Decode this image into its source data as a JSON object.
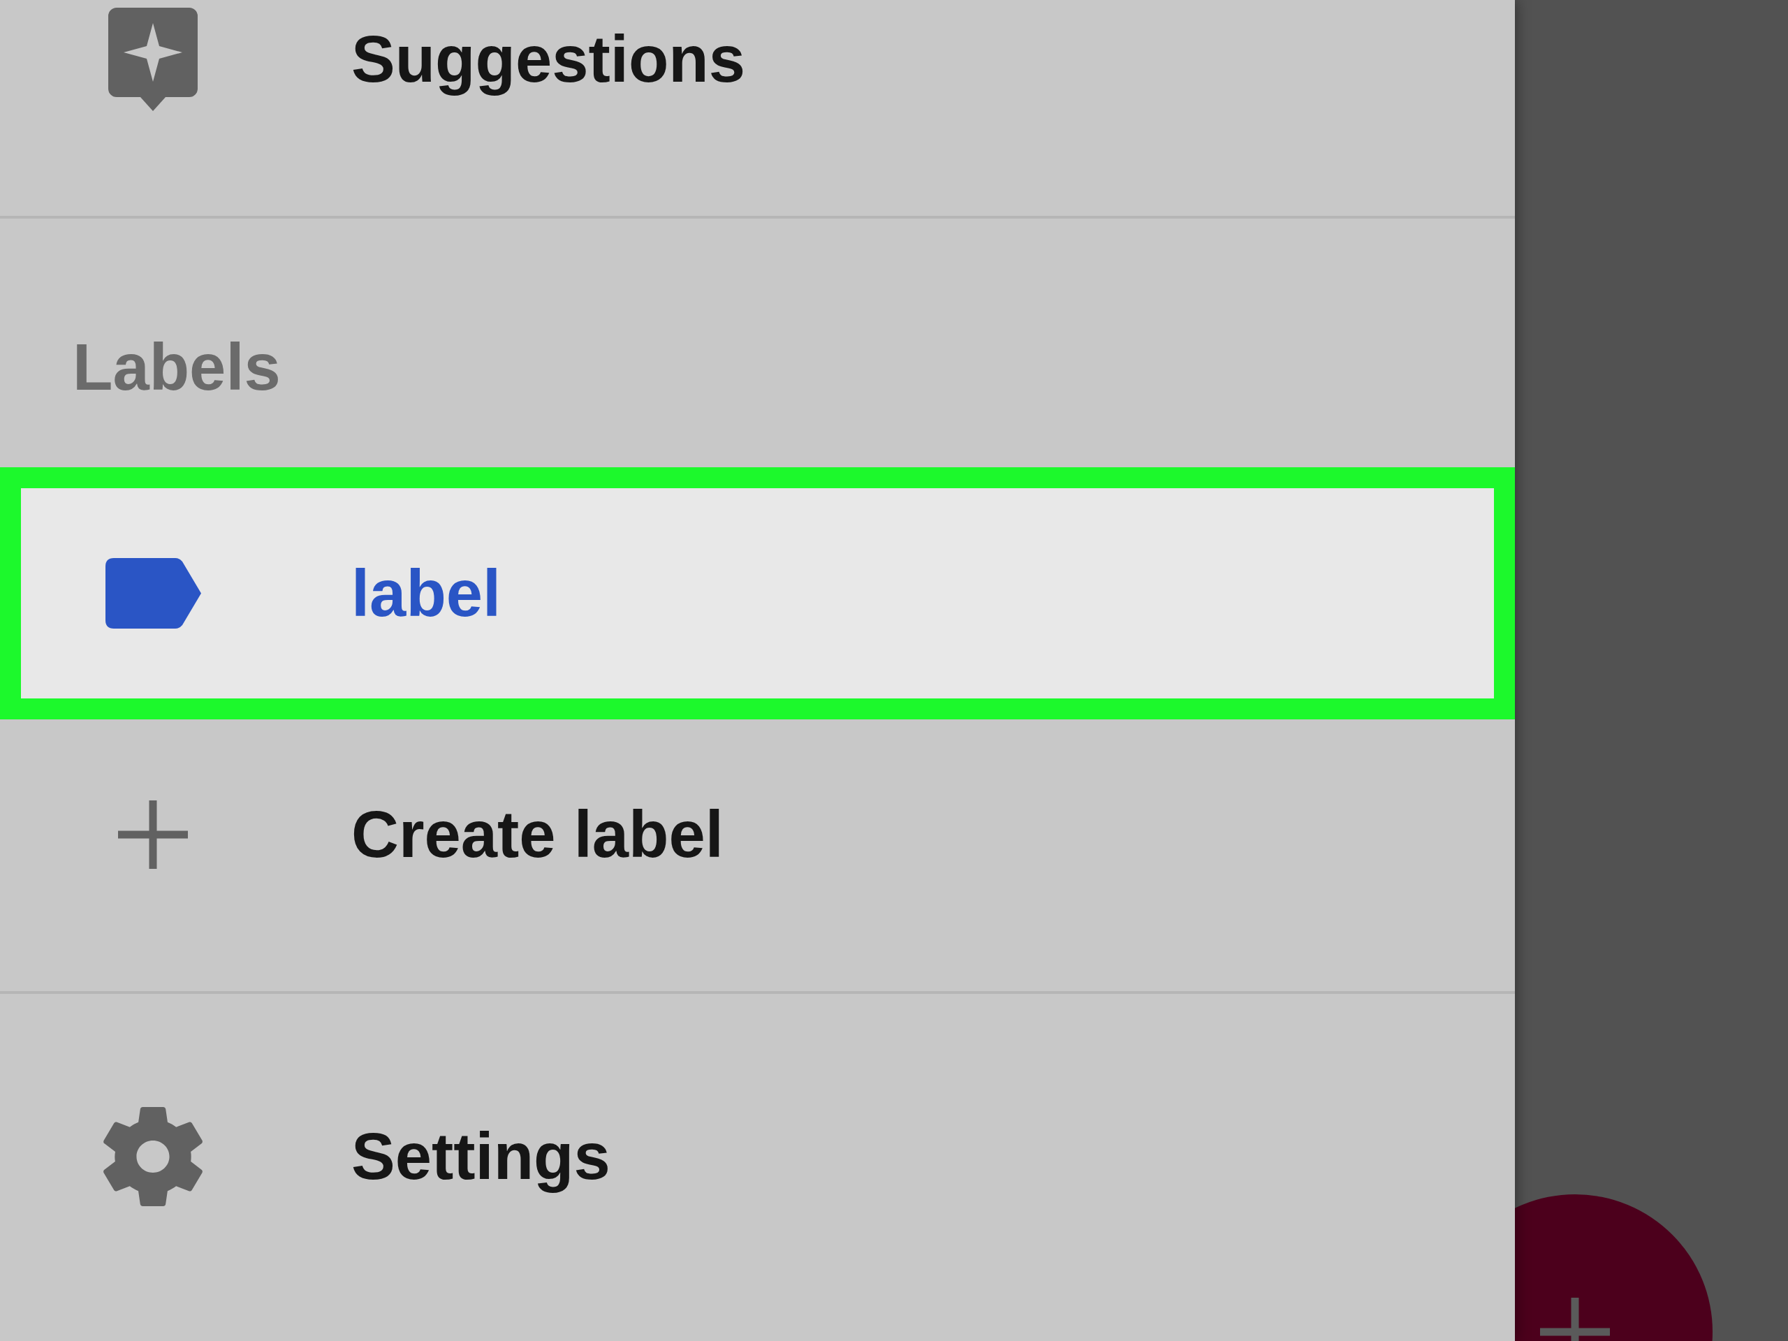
{
  "navigation_drawer": {
    "suggestions": {
      "label": "Suggestions"
    },
    "labels_section": {
      "heading": "Labels",
      "labels": [
        {
          "name": "label",
          "selected": true,
          "highlighted": true
        }
      ],
      "create_label": {
        "label": "Create label"
      }
    },
    "settings": {
      "label": "Settings"
    }
  }
}
